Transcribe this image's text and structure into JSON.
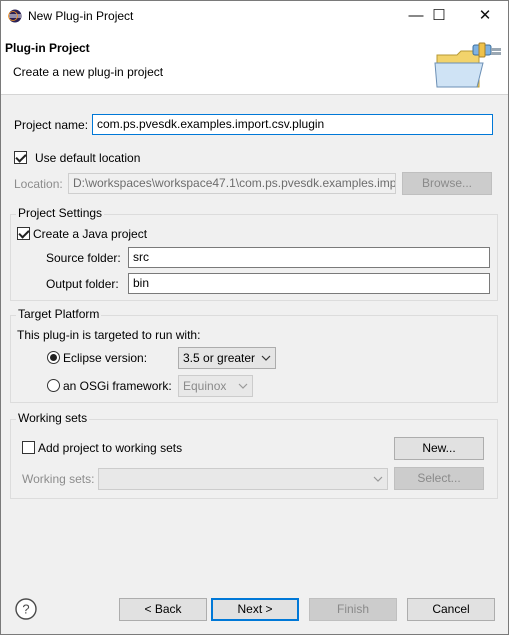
{
  "window": {
    "title": "New Plug-in Project",
    "icon": "eclipse-icon"
  },
  "titlebar_buttons": {
    "minimize": "—",
    "maximize": "☐",
    "close": "✕"
  },
  "banner": {
    "title": "Plug-in Project",
    "subtitle": "Create a new plug-in project",
    "image": "plugin-folder-icon"
  },
  "project": {
    "name_label": "Project name:",
    "name_value": "com.ps.pvesdk.examples.import.csv.plugin",
    "use_default_location_label": "Use default location",
    "use_default_location_checked": true,
    "location_label": "Location:",
    "location_value": "D:\\workspaces\\workspace47.1\\com.ps.pvesdk.examples.imp",
    "browse_label": "Browse..."
  },
  "project_settings": {
    "title": "Project Settings",
    "create_java_label": "Create a Java project",
    "create_java_checked": true,
    "source_label": "Source folder:",
    "source_value": "src",
    "output_label": "Output folder:",
    "output_value": "bin"
  },
  "target_platform": {
    "title": "Target Platform",
    "intro": "This plug-in is targeted to run with:",
    "eclipse_label": "Eclipse version:",
    "eclipse_selected": true,
    "eclipse_value": "3.5 or greater",
    "osgi_label": "an OSGi framework:",
    "osgi_value": "Equinox"
  },
  "working_sets": {
    "title": "Working sets",
    "add_label": "Add project to working sets",
    "add_checked": false,
    "new_label": "New...",
    "sets_label": "Working sets:",
    "sets_value": "",
    "select_label": "Select..."
  },
  "footer": {
    "back": "< Back",
    "next": "Next >",
    "finish": "Finish",
    "cancel": "Cancel",
    "help_icon": "help-icon"
  }
}
